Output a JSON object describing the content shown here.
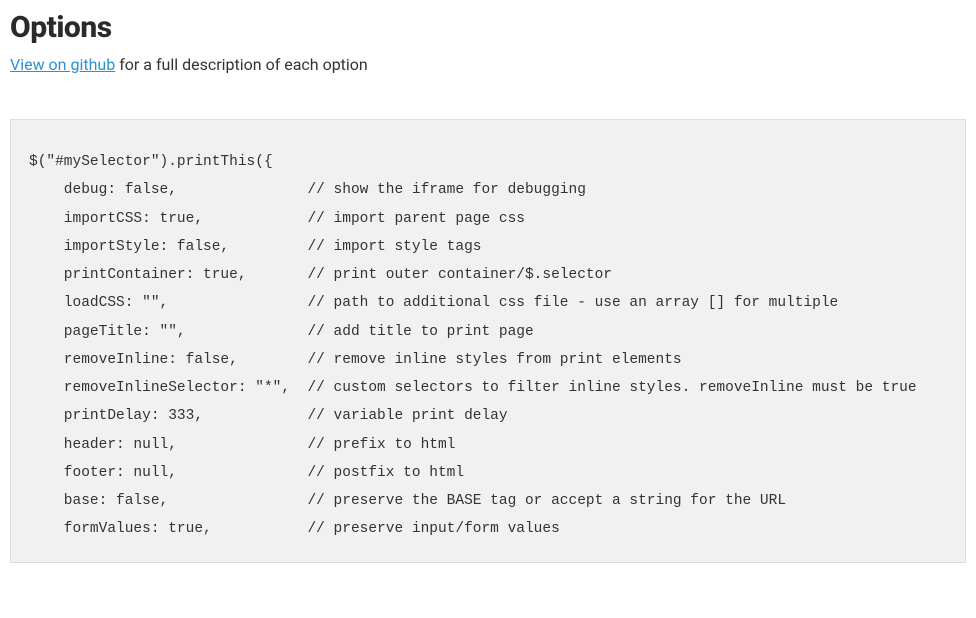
{
  "heading": "Options",
  "link_text": "View on github",
  "subtitle_rest": " for a full description of each option",
  "code": "$(\"#mySelector\").printThis({\n    debug: false,               // show the iframe for debugging\n    importCSS: true,            // import parent page css\n    importStyle: false,         // import style tags\n    printContainer: true,       // print outer container/$.selector\n    loadCSS: \"\",                // path to additional css file - use an array [] for multiple\n    pageTitle: \"\",              // add title to print page\n    removeInline: false,        // remove inline styles from print elements\n    removeInlineSelector: \"*\",  // custom selectors to filter inline styles. removeInline must be true\n    printDelay: 333,            // variable print delay\n    header: null,               // prefix to html\n    footer: null,               // postfix to html\n    base: false,                // preserve the BASE tag or accept a string for the URL\n    formValues: true,           // preserve input/form values"
}
